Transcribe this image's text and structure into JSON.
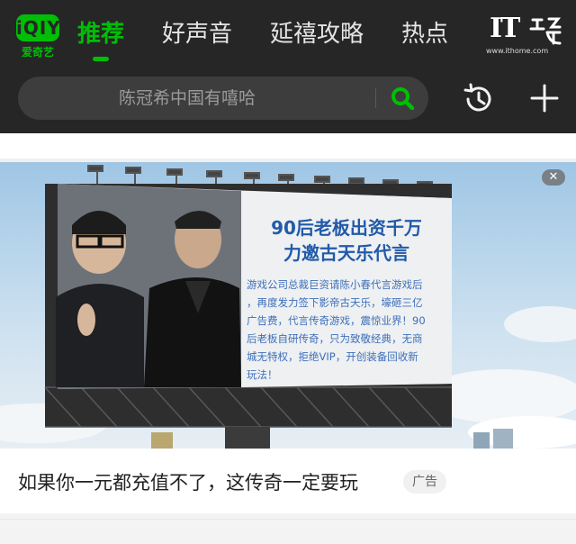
{
  "app": {
    "logo_mark": "iQIY",
    "logo_text": "爱奇艺",
    "accent_color": "#00be06"
  },
  "tabs": [
    {
      "label": "推荐",
      "active": true
    },
    {
      "label": "好声音",
      "active": false
    },
    {
      "label": "延禧攻略",
      "active": false
    },
    {
      "label": "热点",
      "active": false
    }
  ],
  "watermark": {
    "logo": "IT",
    "url": "www.ithome.com"
  },
  "search": {
    "placeholder": "陈冠希中国有嘻哈",
    "icon": "search-icon"
  },
  "toolbar": {
    "history_icon": "history-icon",
    "add_icon": "plus-icon"
  },
  "ad": {
    "billboard": {
      "headline_line1": "90后老板出资千万",
      "headline_line2": "力邀古天乐代言",
      "body_lines": [
        "游戏公司总裁巨资请陈小春代言游戏后",
        "，再度发力签下影帝古天乐，壕砸三亿",
        "广告费，代言传奇游戏，震惊业界！90",
        "后老板自研传奇，只为致敬经典，无商",
        "城无特权，拒绝VIP，开创装备回收新",
        "玩法！"
      ]
    },
    "title": "如果你一元都充值不了，这传奇一定要玩",
    "tag": "广告",
    "close_label": "✕"
  }
}
